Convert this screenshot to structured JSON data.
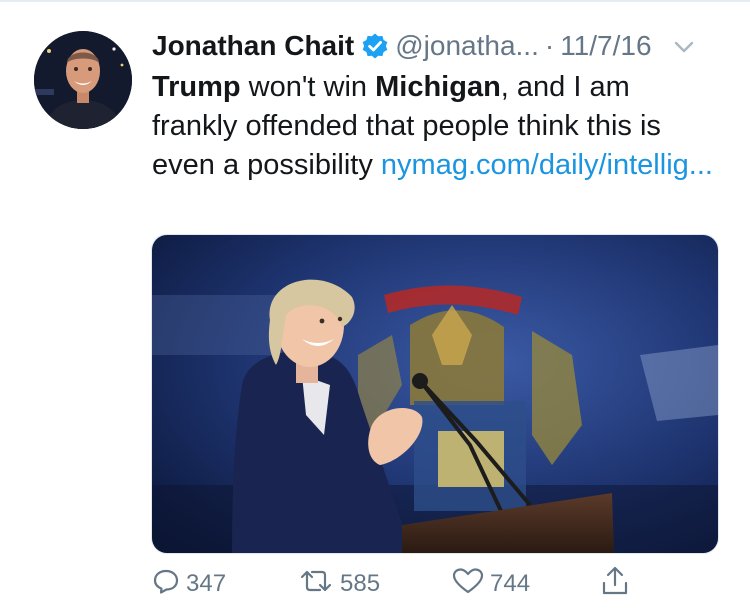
{
  "tweet": {
    "author_name": "Jonathan Chait",
    "handle": "@jonatha...",
    "separator": "·",
    "date": "11/7/16",
    "text_parts": {
      "w1": "Trump",
      "t1": " won't win ",
      "w2": "Michigan",
      "t2": ", and I am frankly offended that people think this is even a possibility "
    },
    "link_text": "nymag.com/daily/intellig..."
  },
  "actions": {
    "reply_count": "347",
    "retweet_count": "585",
    "like_count": "744"
  },
  "icons": {
    "verified": "verified-badge-icon",
    "chevron": "chevron-down-icon",
    "reply": "reply-icon",
    "retweet": "retweet-icon",
    "like": "heart-icon",
    "share": "share-icon"
  },
  "colors": {
    "link": "#1b95e0",
    "secondary_text": "#657786",
    "verified": "#1da1f2"
  }
}
